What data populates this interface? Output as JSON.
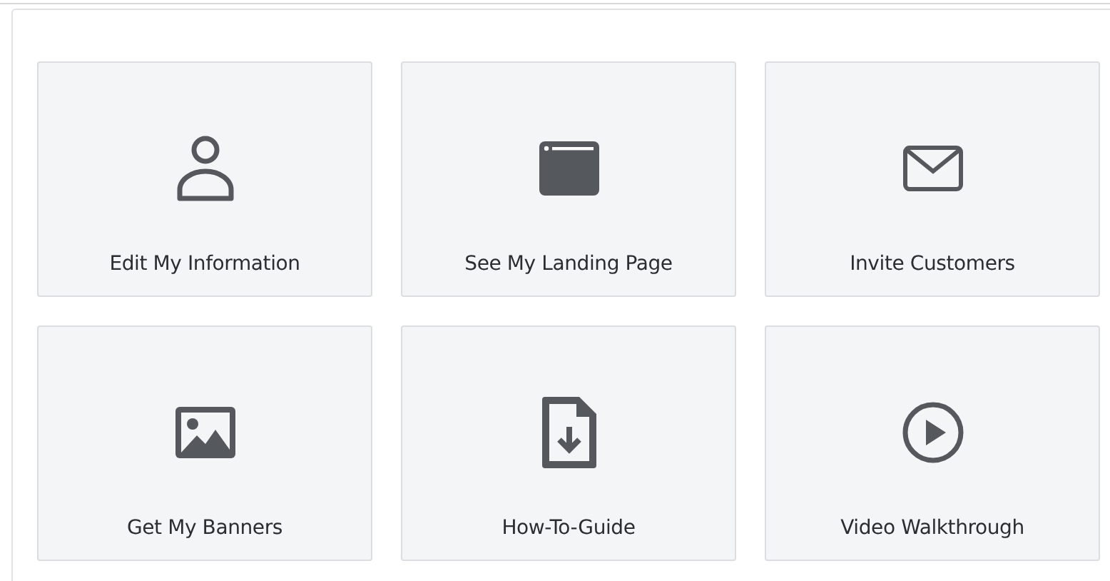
{
  "tiles": [
    {
      "kind": "person",
      "label": "Edit My Information"
    },
    {
      "kind": "browser",
      "label": "See My Landing Page"
    },
    {
      "kind": "mail",
      "label": "Invite Customers"
    },
    {
      "kind": "image",
      "label": "Get My Banners"
    },
    {
      "kind": "download",
      "label": "How-To-Guide"
    },
    {
      "kind": "play",
      "label": "Video Walkthrough"
    }
  ]
}
